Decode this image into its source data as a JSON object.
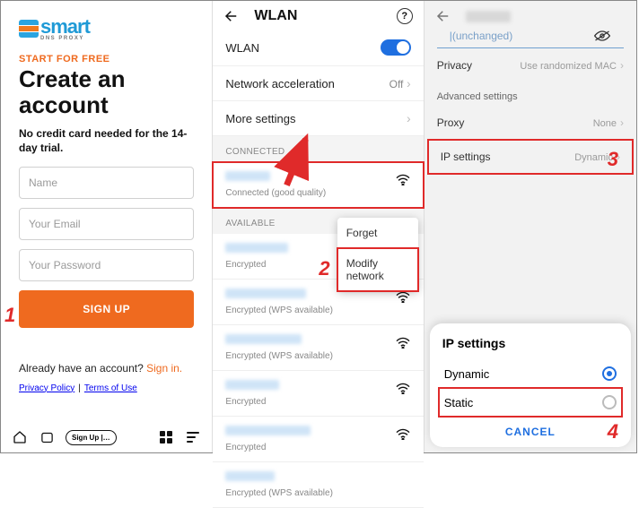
{
  "panel1": {
    "logo_text": "smart",
    "logo_sub": "DNS PROXY",
    "start": "START FOR FREE",
    "heading": "Create an account",
    "subhead": "No credit card needed for the 14-day trial.",
    "name_ph": "Name",
    "email_ph": "Your Email",
    "pass_ph": "Your Password",
    "signup_btn": "SIGN UP",
    "already_prefix": "Already have an account? ",
    "signin": "Sign in.",
    "privacy": "Privacy Policy",
    "terms": "Terms of Use",
    "pill": "Sign Up |…"
  },
  "panel2": {
    "title": "WLAN",
    "rows": {
      "wlan": "WLAN",
      "accel": "Network acceleration",
      "accel_val": "Off",
      "more": "More settings"
    },
    "sec_connected": "CONNECTED",
    "connected_status": "Connected (good quality)",
    "sec_available": "AVAILABLE",
    "enc": "Encrypted",
    "enc_wps": "Encrypted (WPS available)",
    "popup": {
      "forget": "Forget",
      "modify": "Modify network"
    }
  },
  "panel3": {
    "unchanged": "(unchanged)",
    "privacy": "Privacy",
    "privacy_val": "Use randomized MAC",
    "adv": "Advanced settings",
    "proxy": "Proxy",
    "proxy_val": "None",
    "ip": "IP settings",
    "ip_val": "Dynamic",
    "sheet_title": "IP settings",
    "dynamic": "Dynamic",
    "static": "Static",
    "cancel": "CANCEL"
  },
  "steps": {
    "s1": "1",
    "s2": "2",
    "s3": "3",
    "s4": "4"
  }
}
